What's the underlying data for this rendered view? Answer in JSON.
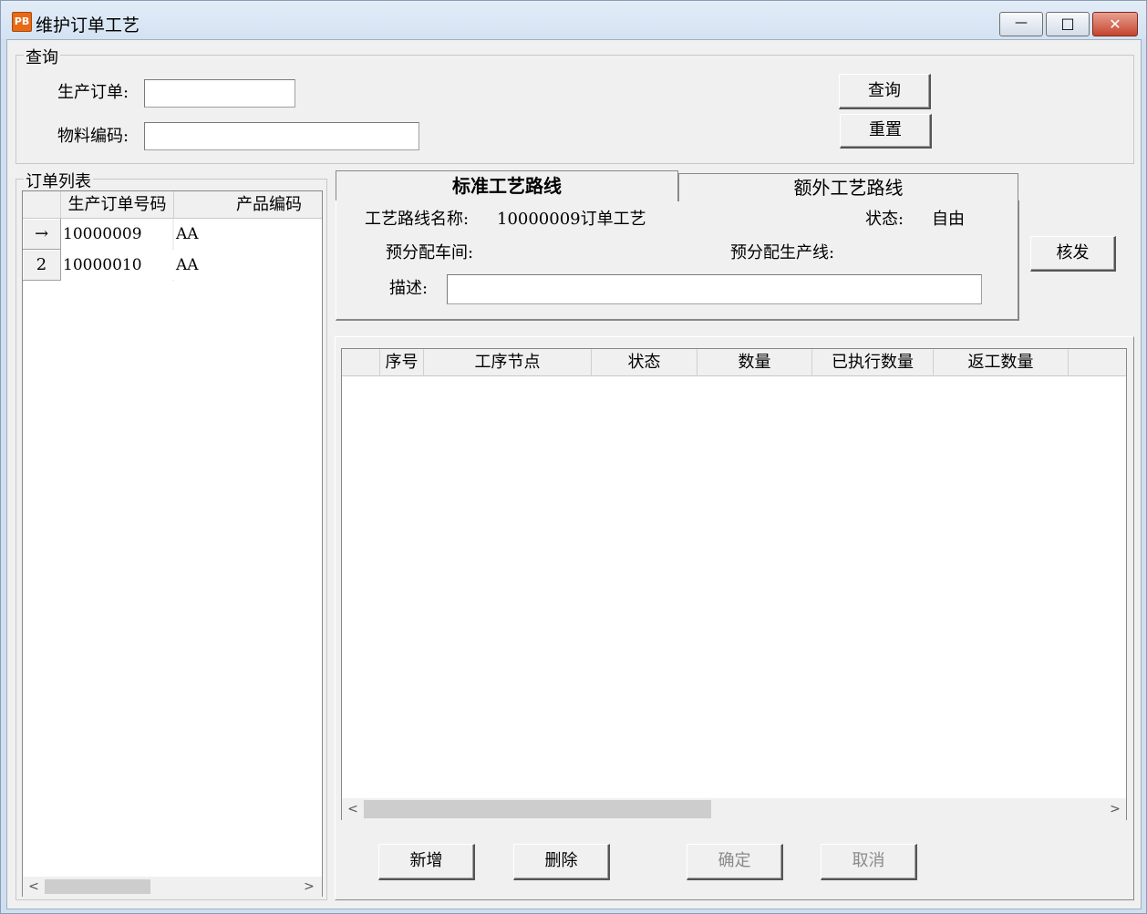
{
  "window": {
    "title": "维护订单工艺",
    "app_icon_text": "PB",
    "controls": {
      "minimize": "—",
      "maximize": "□",
      "close": "✕"
    }
  },
  "query": {
    "group_label": "查询",
    "order_label": "生产订单:",
    "order_value": "",
    "material_label": "物料编码:",
    "material_value": "",
    "search_button": "查询",
    "reset_button": "重置"
  },
  "order_list": {
    "group_label": "订单列表",
    "columns": [
      "生产订单号码",
      "产品编码"
    ],
    "rows": [
      {
        "indicator": "→",
        "order_no": "10000009",
        "product_code": "AA"
      },
      {
        "indicator": "2",
        "order_no": "10000010",
        "product_code": "AA"
      }
    ]
  },
  "tabs": {
    "standard": "标准工艺路线",
    "extra": "额外工艺路线",
    "active": "standard"
  },
  "route": {
    "name_label": "工艺路线名称:",
    "name_value": "10000009订单工艺",
    "status_label": "状态:",
    "status_value": "自由",
    "workshop_label": "预分配车间:",
    "workshop_value": "",
    "line_label": "预分配生产线:",
    "line_value": "",
    "desc_label": "描述:",
    "desc_value": "",
    "issue_button": "核发"
  },
  "process_grid": {
    "columns": [
      "序号",
      "工序节点",
      "状态",
      "数量",
      "已执行数量",
      "返工数量"
    ]
  },
  "actions": {
    "add": "新增",
    "delete": "删除",
    "confirm": "确定",
    "cancel": "取消"
  },
  "scroll": {
    "left_arrow": "<",
    "right_arrow": ">"
  }
}
